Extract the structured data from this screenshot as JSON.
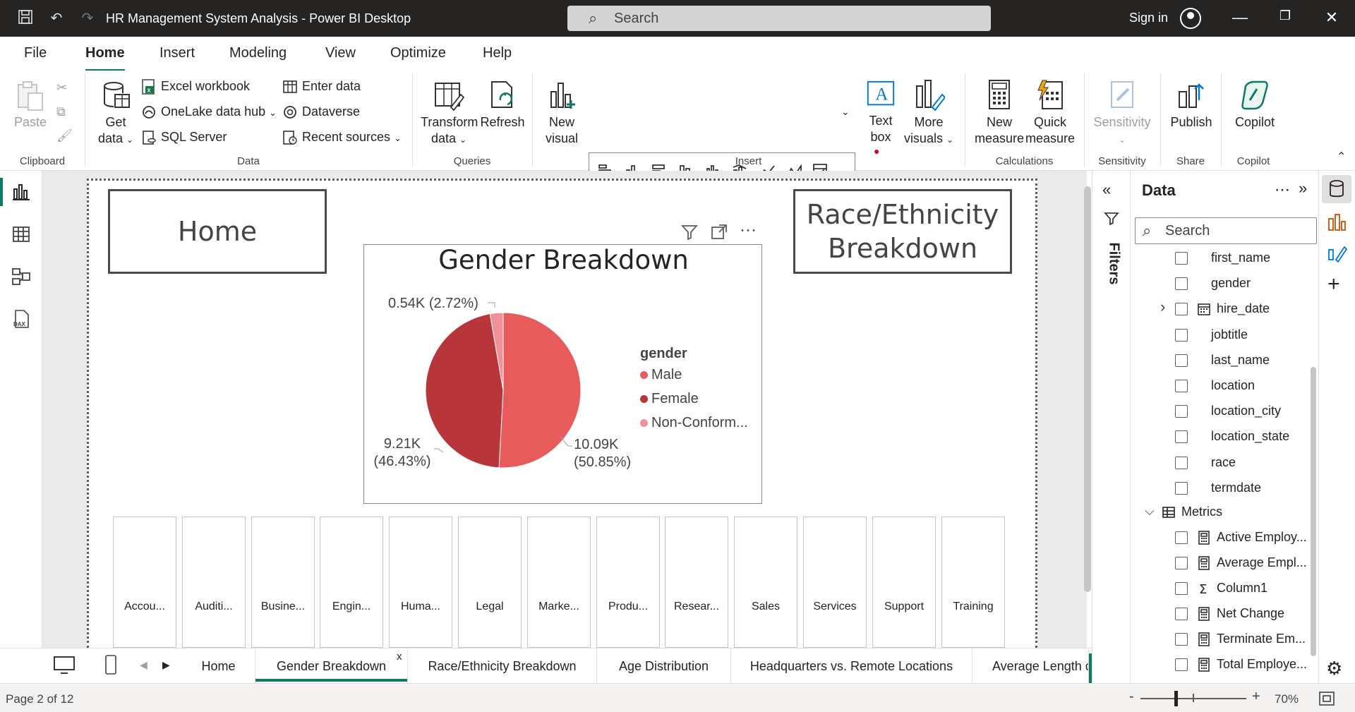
{
  "window": {
    "title": "HR Management System Analysis - Power BI Desktop",
    "search_placeholder": "Search",
    "signin": "Sign in"
  },
  "menu": {
    "tabs": [
      "File",
      "Home",
      "Insert",
      "Modeling",
      "View",
      "Optimize",
      "Help"
    ],
    "active": "Home"
  },
  "ribbon": {
    "clipboard": {
      "paste": "Paste",
      "label": "Clipboard"
    },
    "data": {
      "get_data_1": "Get",
      "get_data_2": "data",
      "excel": "Excel workbook",
      "onelake": "OneLake data hub",
      "sql": "SQL Server",
      "enter_data": "Enter data",
      "dataverse": "Dataverse",
      "recent": "Recent sources",
      "label": "Data"
    },
    "queries": {
      "transform_1": "Transform",
      "transform_2": "data",
      "refresh": "Refresh",
      "label": "Queries"
    },
    "insert": {
      "new_visual_1": "New",
      "new_visual_2": "visual",
      "text_box_1": "Text",
      "text_box_2": "box",
      "more_visuals_1": "More",
      "more_visuals_2": "visuals",
      "label": "Insert"
    },
    "calculations": {
      "new_measure_1": "New",
      "new_measure_2": "measure",
      "quick_measure_1": "Quick",
      "quick_measure_2": "measure",
      "label": "Calculations"
    },
    "sensitivity": {
      "btn": "Sensitivity",
      "label": "Sensitivity"
    },
    "share": {
      "publish": "Publish",
      "label": "Share"
    },
    "copilot": {
      "btn": "Copilot",
      "label": "Copilot"
    }
  },
  "canvas": {
    "home_button": "Home",
    "race_button_1": "Race/Ethnicity",
    "race_button_2": "Breakdown",
    "chart": {
      "title": "Gender Breakdown",
      "legend_title": "gender",
      "labels": {
        "male_1": "10.09K",
        "male_2": "(50.85%)",
        "female_1": "9.21K",
        "female_2": "(46.43%)",
        "nonconf": "0.54K (2.72%)"
      }
    },
    "slicers": [
      "Accou...",
      "Auditi...",
      "Busine...",
      "Engin...",
      "Huma...",
      "Legal",
      "Marke...",
      "Produ...",
      "Resear...",
      "Sales",
      "Services",
      "Support",
      "Training"
    ]
  },
  "chart_data": {
    "type": "pie",
    "title": "Gender Breakdown",
    "legend_title": "gender",
    "categories": [
      "Male",
      "Female",
      "Non-Conform..."
    ],
    "values": [
      10090,
      9210,
      540
    ],
    "percent": [
      50.85,
      46.43,
      2.72
    ],
    "colors": [
      "#E85B5B",
      "#B8353A",
      "#F09098"
    ],
    "legend_position": "right"
  },
  "pages": {
    "tabs": [
      "Home",
      "Gender Breakdown",
      "Race/Ethnicity Breakdown",
      "Age Distribution",
      "Headquarters vs. Remote Locations",
      "Average Length o"
    ],
    "active": "Gender Breakdown",
    "close": "x",
    "add": "+"
  },
  "status": {
    "page": "Page 2 of 12",
    "zoom": "70%",
    "minus": "-",
    "plus": "+"
  },
  "filters": {
    "label": "Filters"
  },
  "data_pane": {
    "title": "Data",
    "search_placeholder": "Search",
    "fields": [
      "first_name",
      "gender",
      "hire_date",
      "jobtitle",
      "last_name",
      "location",
      "location_city",
      "location_state",
      "race",
      "termdate"
    ],
    "metrics_table": "Metrics",
    "measures": [
      "Active Employ...",
      "Average Empl...",
      "Column1",
      "Net Change",
      "Terminate Em...",
      "Total Employe..."
    ]
  }
}
